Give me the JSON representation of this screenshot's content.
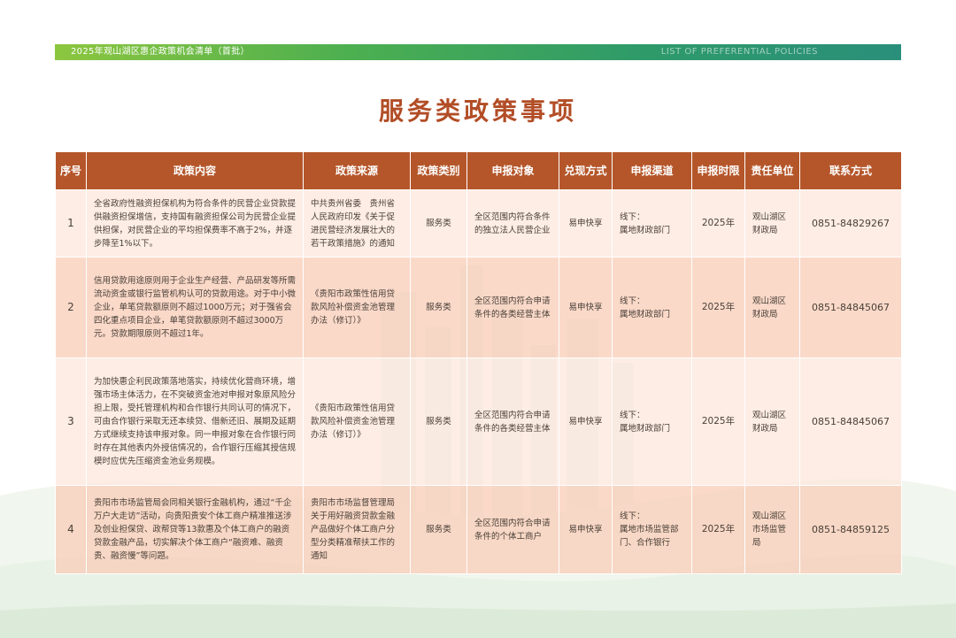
{
  "header": {
    "title": "2025年观山湖区惠企政策机会清单（首批）",
    "subtitle": "LIST OF PREFERENTIAL POLICIES"
  },
  "page_title": "服务类政策事项",
  "table": {
    "columns": [
      "序号",
      "政策内容",
      "政策来源",
      "政策类别",
      "申报对象",
      "兑现方式",
      "申报渠道",
      "申报时限",
      "责任单位",
      "联系方式"
    ],
    "rows": [
      {
        "no": "1",
        "content": "全省政府性融资担保机构为符合条件的民营企业贷款提供融资担保增信，支持国有融资担保公司为民营企业提供担保，对民营企业的平均担保费率不高于2%，并逐步降至1%以下。",
        "source": "中共贵州省委　贵州省人民政府印发《关于促进民营经济发展壮大的若干政策措施》的通知",
        "category": "服务类",
        "target": "全区范围内符合条件的独立法人民营企业",
        "method": "易申快享",
        "channel": "线下：\n属地财政部门",
        "deadline": "2025年",
        "unit": "观山湖区财政局",
        "contact": "0851-84829267"
      },
      {
        "no": "2",
        "content": "信用贷款用途原则用于企业生产经营、产品研发等所需流动资金或银行监管机构认可的贷款用途。对于中小微企业，单笔贷款额原则不超过1000万元；对于强省会四化重点项目企业，单笔贷款额原则不超过3000万元。贷款期限原则不超过1年。",
        "source": "《贵阳市政策性信用贷款风险补偿资金池管理办法（修订）》",
        "category": "服务类",
        "target": "全区范围内符合申请条件的各类经营主体",
        "method": "易申快享",
        "channel": "线下：\n属地财政部门",
        "deadline": "2025年",
        "unit": "观山湖区财政局",
        "contact": "0851-84845067"
      },
      {
        "no": "3",
        "content": "为加快惠企利民政策落地落实，持续优化营商环境，增强市场主体活力，在不突破资金池对申报对象原风险分担上限，受托管理机构和合作银行共同认可的情况下，可由合作银行采取无还本续贷、借新还旧、展期及延期方式继续支持该申报对象。同一申报对象在合作银行同时存在其他表内外授信情况的，合作银行压缩其授信规模时应优先压缩资金池业务规模。",
        "source": "《贵阳市政策性信用贷款风险补偿资金池管理办法（修订）》",
        "category": "服务类",
        "target": "全区范围内符合申请条件的各类经营主体",
        "method": "易申快享",
        "channel": "线下：\n属地财政部门",
        "deadline": "2025年",
        "unit": "观山湖区财政局",
        "contact": "0851-84845067"
      },
      {
        "no": "4",
        "content": "贵阳市市场监管局会同相关银行金融机构，通过“千企万户大走访”活动，向贵阳贵安个体工商户精准推送涉及创业担保贷、政帮贷等13款惠及个体工商户的融资贷款金融产品，切实解决个体工商户“融资难、融资贵、融资慢”等问题。",
        "source": "贵阳市市场监督管理局关于用好融资贷款金融产品做好个体工商户分型分类精准帮扶工作的通知",
        "category": "服务类",
        "target": "全区范围内符合申请条件的个体工商户",
        "method": "易申快享",
        "channel": "线下：\n属地市场监管部门、合作银行",
        "deadline": "2025年",
        "unit": "观山湖区市场监管局",
        "contact": "0851-84859125"
      }
    ]
  }
}
